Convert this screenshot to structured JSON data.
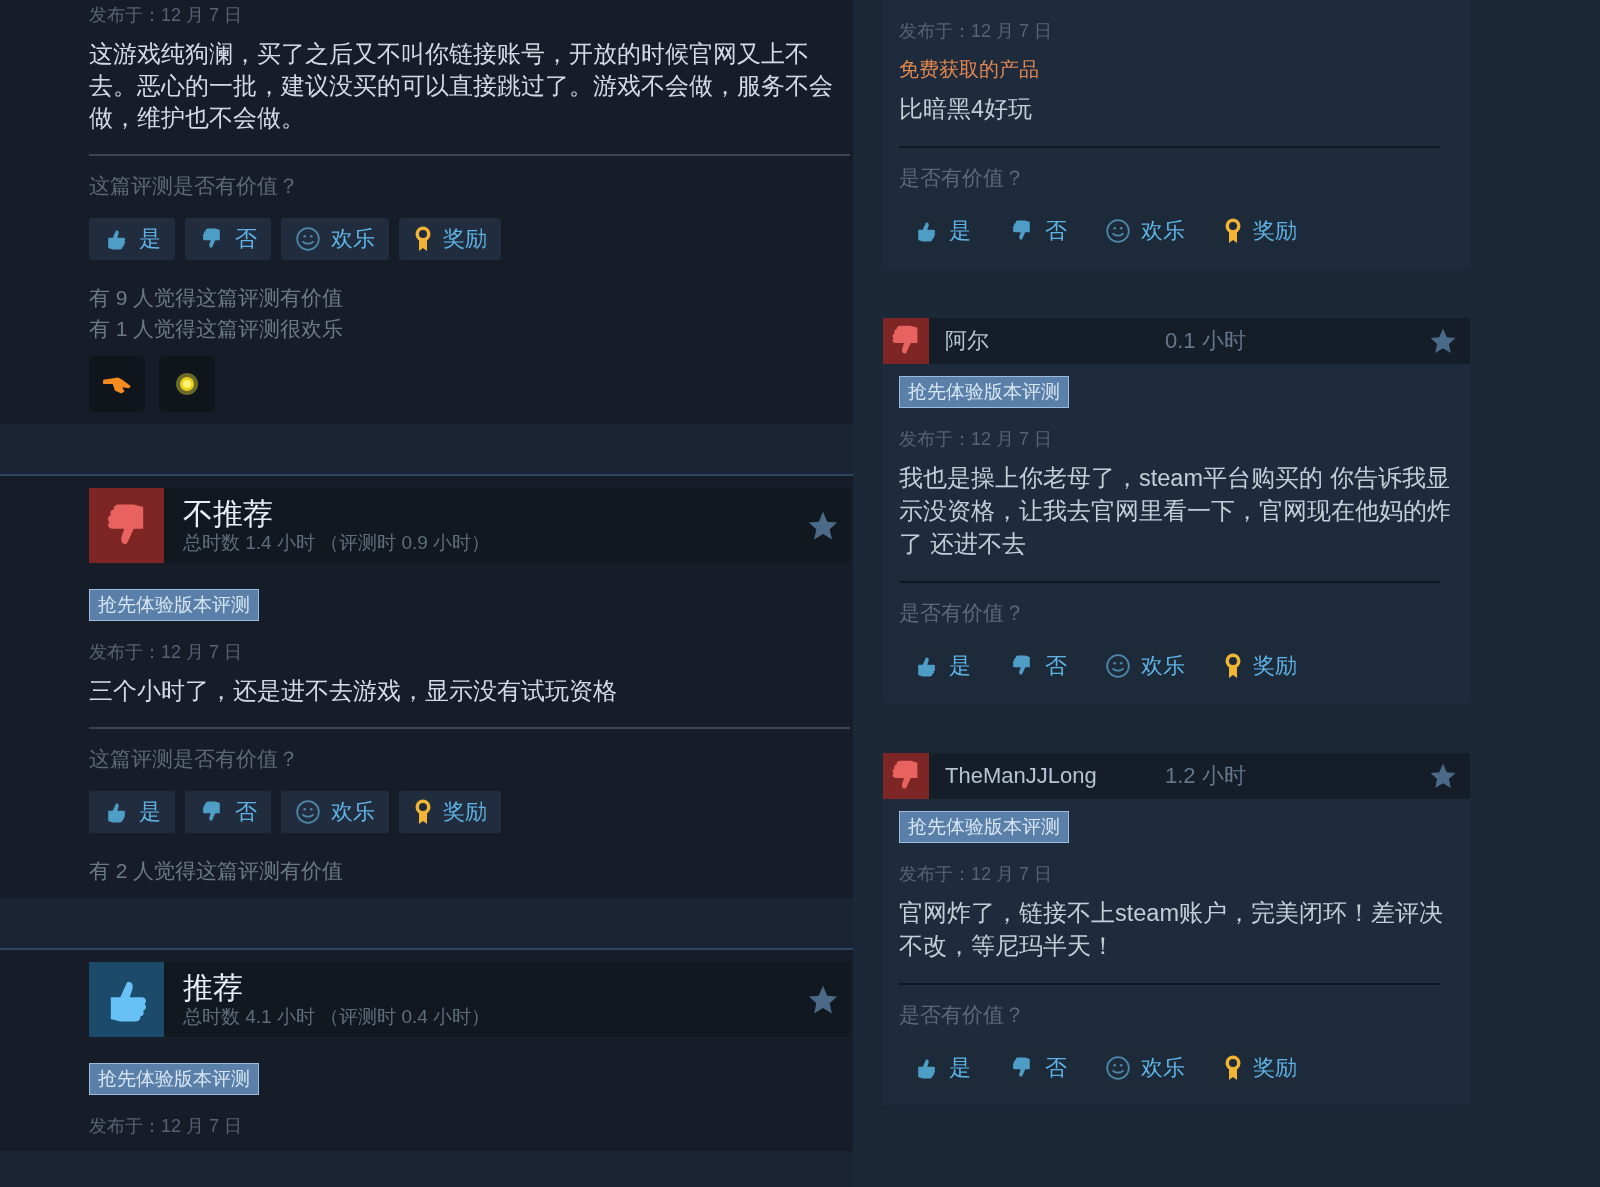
{
  "left_column": {
    "reviews": [
      {
        "date": "发布于：12 月 7 日",
        "text": "这游戏纯狗澜，买了之后又不叫你链接账号，开放的时候官网又上不去。恶心的一批，建议没买的可以直接跳过了。游戏不会做，服务不会做，维护也不会做。",
        "question": "这篇评测是否有价值？",
        "buttons": [
          {
            "kind": "yes",
            "label": "是"
          },
          {
            "kind": "no",
            "label": "否"
          },
          {
            "kind": "funny",
            "label": "欢乐"
          },
          {
            "kind": "award",
            "label": "奖励"
          }
        ],
        "counts": [
          "有 9 人觉得这篇评测有价值",
          "有 1 人觉得这篇评测很欢乐"
        ],
        "awards": [
          {
            "kind": "pointing-hand"
          },
          {
            "kind": "glowing-orb"
          }
        ]
      },
      {
        "recommended": false,
        "verdict": "不推荐",
        "playtime": "总时数 1.4 小时 （评测时 0.9 小时）",
        "tag": "抢先体验版本评测",
        "date": "发布于：12 月 7 日",
        "text": "三个小时了，还是进不去游戏，显示没有试玩资格",
        "question": "这篇评测是否有价值？",
        "buttons": [
          {
            "kind": "yes",
            "label": "是"
          },
          {
            "kind": "no",
            "label": "否"
          },
          {
            "kind": "funny",
            "label": "欢乐"
          },
          {
            "kind": "award",
            "label": "奖励"
          }
        ],
        "counts": [
          "有 2 人觉得这篇评测有价值"
        ]
      },
      {
        "recommended": true,
        "verdict": "推荐",
        "playtime": "总时数 4.1 小时 （评测时 0.4 小时）",
        "tag": "抢先体验版本评测",
        "date": "发布于：12 月 7 日"
      }
    ]
  },
  "right_column": {
    "reviews": [
      {
        "date": "发布于：12 月 7 日",
        "product_note": "免费获取的产品",
        "text": "比暗黑4好玩",
        "question": "是否有价值？",
        "buttons": [
          {
            "kind": "yes",
            "label": "是"
          },
          {
            "kind": "no",
            "label": "否"
          },
          {
            "kind": "funny",
            "label": "欢乐"
          },
          {
            "kind": "award",
            "label": "奖励"
          }
        ]
      },
      {
        "recommended": false,
        "author": "阿尔",
        "playtime": "0.1 小时",
        "tag": "抢先体验版本评测",
        "date": "发布于：12 月 7 日",
        "text": "我也是操上你老母了，steam平台购买的 你告诉我显示没资格，让我去官网里看一下，官网现在他妈的炸了 还进不去",
        "question": "是否有价值？",
        "buttons": [
          {
            "kind": "yes",
            "label": "是"
          },
          {
            "kind": "no",
            "label": "否"
          },
          {
            "kind": "funny",
            "label": "欢乐"
          },
          {
            "kind": "award",
            "label": "奖励"
          }
        ]
      },
      {
        "recommended": false,
        "author": "TheManJJLong",
        "playtime": "1.2 小时",
        "tag": "抢先体验版本评测",
        "date": "发布于：12 月 7 日",
        "text": "官网炸了，链接不上steam账户，完美闭环！差评决不改，等尼玛半天！",
        "question": "是否有价值？",
        "buttons": [
          {
            "kind": "yes",
            "label": "是"
          },
          {
            "kind": "no",
            "label": "否"
          },
          {
            "kind": "funny",
            "label": "欢乐"
          },
          {
            "kind": "award",
            "label": "奖励"
          }
        ]
      }
    ]
  }
}
